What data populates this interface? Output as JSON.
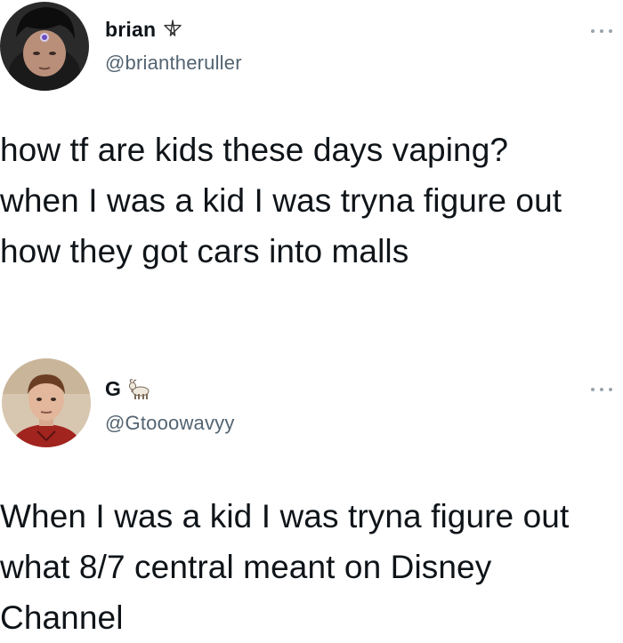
{
  "tweets": [
    {
      "display_name": "brian",
      "name_emoji": "pentagram-icon",
      "handle": "@briantheruller",
      "text": "how tf are kids these days vaping?\nwhen I was a kid I was tryna figure out\nhow they got cars into malls"
    },
    {
      "display_name": "G",
      "name_emoji": "goat-icon",
      "handle": "@Gtooowavyy",
      "text": "When I was a kid I was tryna figure out\nwhat 8/7 central meant on Disney\nChannel"
    }
  ]
}
